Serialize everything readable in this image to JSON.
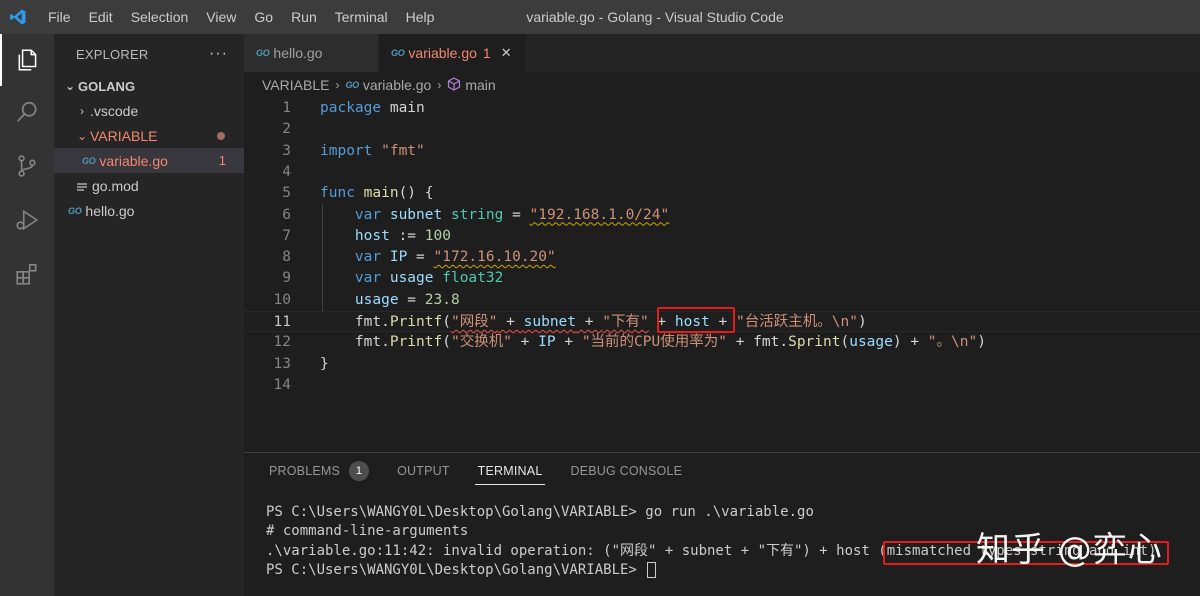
{
  "menu": [
    "File",
    "Edit",
    "Selection",
    "View",
    "Go",
    "Run",
    "Terminal",
    "Help"
  ],
  "window_title": "variable.go - Golang - Visual Studio Code",
  "activity_icons": [
    "explorer-icon",
    "search-icon",
    "source-control-icon",
    "run-debug-icon",
    "extensions-icon"
  ],
  "sidebar": {
    "title": "EXPLORER",
    "more": "···",
    "workspace": "GOLANG",
    "go_badge": "GO",
    "items": [
      {
        "label": ".vscode",
        "type": "folder-collapsed"
      },
      {
        "label": "VARIABLE",
        "type": "folder-expanded"
      },
      {
        "label": "variable.go",
        "type": "go-file",
        "problems": "1"
      },
      {
        "label": "go.mod",
        "type": "mod-file"
      },
      {
        "label": "hello.go",
        "type": "go-file"
      }
    ]
  },
  "tabs": [
    {
      "label": "hello.go"
    },
    {
      "label": "variable.go",
      "problems": "1",
      "close": "✕"
    }
  ],
  "breadcrumb": {
    "folder": "VARIABLE",
    "file": "variable.go",
    "symbol": "main"
  },
  "editor": {
    "line_numbers": [
      "1",
      "2",
      "3",
      "4",
      "5",
      "6",
      "7",
      "8",
      "9",
      "10",
      "11",
      "12",
      "13",
      "14"
    ],
    "lines": [
      [
        {
          "t": "package ",
          "c": "kw"
        },
        {
          "t": "main",
          "c": "plain"
        }
      ],
      [],
      [
        {
          "t": "import ",
          "c": "kw"
        },
        {
          "t": "\"fmt\"",
          "c": "str"
        }
      ],
      [],
      [
        {
          "t": "func ",
          "c": "kw"
        },
        {
          "t": "main",
          "c": "fn"
        },
        {
          "t": "() {",
          "c": "plain"
        }
      ],
      [
        {
          "t": "    var ",
          "c": "kw"
        },
        {
          "t": "subnet ",
          "c": "var"
        },
        {
          "t": "string",
          "c": "typ"
        },
        {
          "t": " = ",
          "c": "plain"
        },
        {
          "t": "\"192.168.1.0/24\"",
          "c": "str",
          "u": "warn"
        }
      ],
      [
        {
          "t": "    host",
          "c": "var"
        },
        {
          "t": " := ",
          "c": "plain"
        },
        {
          "t": "100",
          "c": "num"
        }
      ],
      [
        {
          "t": "    var ",
          "c": "kw"
        },
        {
          "t": "IP",
          "c": "var"
        },
        {
          "t": " = ",
          "c": "plain"
        },
        {
          "t": "\"172.16.10.20\"",
          "c": "str",
          "u": "warn"
        }
      ],
      [
        {
          "t": "    var ",
          "c": "kw"
        },
        {
          "t": "usage ",
          "c": "var"
        },
        {
          "t": "float32",
          "c": "typ"
        }
      ],
      [
        {
          "t": "    usage",
          "c": "var"
        },
        {
          "t": " = ",
          "c": "plain"
        },
        {
          "t": "23.8",
          "c": "num"
        }
      ],
      [
        {
          "t": "    fmt.",
          "c": "plain"
        },
        {
          "t": "Printf",
          "c": "fn"
        },
        {
          "t": "(",
          "c": "plain"
        },
        {
          "t": "\"网段\"",
          "c": "str",
          "u": "err"
        },
        {
          "t": " + ",
          "c": "plain",
          "u": "err"
        },
        {
          "t": "subnet",
          "c": "var",
          "u": "err"
        },
        {
          "t": " + ",
          "c": "plain",
          "u": "err"
        },
        {
          "t": "\"下有\"",
          "c": "str",
          "u": "err"
        },
        {
          "t": " + ",
          "c": "plain"
        },
        {
          "t": "host",
          "c": "var"
        },
        {
          "t": " + ",
          "c": "plain"
        },
        {
          "t": "\"台活跃主机。\\n\"",
          "c": "str"
        },
        {
          "t": ")",
          "c": "plain"
        }
      ],
      [
        {
          "t": "    fmt.",
          "c": "plain"
        },
        {
          "t": "Printf",
          "c": "fn"
        },
        {
          "t": "(",
          "c": "plain"
        },
        {
          "t": "\"交换机\"",
          "c": "str"
        },
        {
          "t": " + ",
          "c": "plain"
        },
        {
          "t": "IP",
          "c": "var"
        },
        {
          "t": " + ",
          "c": "plain"
        },
        {
          "t": "\"当前的CPU使用率为\"",
          "c": "str"
        },
        {
          "t": " + ",
          "c": "plain"
        },
        {
          "t": "fmt.",
          "c": "plain"
        },
        {
          "t": "Sprint",
          "c": "fn"
        },
        {
          "t": "(",
          "c": "plain"
        },
        {
          "t": "usage",
          "c": "var"
        },
        {
          "t": ") + ",
          "c": "plain"
        },
        {
          "t": "\"。\\n\"",
          "c": "str"
        },
        {
          "t": ")",
          "c": "plain"
        }
      ],
      [
        {
          "t": "}",
          "c": "plain"
        }
      ],
      []
    ]
  },
  "panel": {
    "tabs": [
      {
        "label": "PROBLEMS",
        "badge": "1"
      },
      {
        "label": "OUTPUT"
      },
      {
        "label": "TERMINAL",
        "active": true
      },
      {
        "label": "DEBUG CONSOLE"
      }
    ],
    "terminal_lines": [
      "PS C:\\Users\\WANGY0L\\Desktop\\Golang\\VARIABLE> go run .\\variable.go",
      "# command-line-arguments",
      ".\\variable.go:11:42: invalid operation: (\"网段\" + subnet + \"下有\") + host (mismatched types string and int)",
      "PS C:\\Users\\WANGY0L\\Desktop\\Golang\\VARIABLE> "
    ]
  },
  "watermark": "知乎 @弈心"
}
